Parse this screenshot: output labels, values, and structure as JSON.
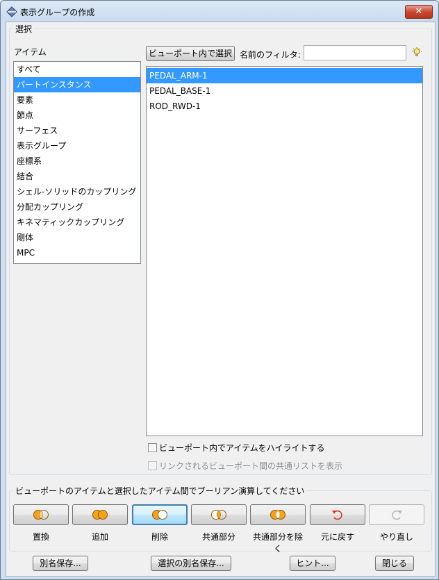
{
  "window": {
    "title": "表示グループの作成",
    "close_label": "✕"
  },
  "selection": {
    "group_label": "選択",
    "items_label": "アイテム",
    "items": [
      "すべて",
      "パートインスタンス",
      "要素",
      "節点",
      "サーフェス",
      "表示グループ",
      "座標系",
      "結合",
      "シェル-ソリッドのカップリング",
      "分配カップリング",
      "キネマティックカップリング",
      "剛体",
      "MPC"
    ],
    "selected_item": "パートインスタンス",
    "viewport_select_label": "ビューポート内で選択",
    "filter_label": "名前のフィルタ:",
    "filter_value": "",
    "instances": [
      "PEDAL_ARM-1",
      "PEDAL_BASE-1",
      "ROD_RWD-1"
    ],
    "selected_instance": "PEDAL_ARM-1",
    "highlight_checkbox": {
      "label": "ビューポート内でアイテムをハイライトする",
      "checked": false
    },
    "linked_checkbox": {
      "label": "リンクされるビューポート間の共通リストを表示",
      "checked": false,
      "enabled": false
    }
  },
  "boolean": {
    "group_label": "ビューポートのアイテムと選択したアイテム間でブーリアン演算してください",
    "ops": [
      {
        "label": "置換",
        "icon": "replace-icon"
      },
      {
        "label": "追加",
        "icon": "union-icon"
      },
      {
        "label": "削除",
        "icon": "remove-icon"
      },
      {
        "label": "共通部分",
        "icon": "intersect-icon"
      },
      {
        "label": "共通部分を除く",
        "icon": "exclusive-or-icon"
      },
      {
        "label": "元に戻す",
        "icon": "undo-icon"
      },
      {
        "label": "やり直し",
        "icon": "redo-icon"
      }
    ]
  },
  "footer": {
    "save_as": "別名保存...",
    "save_selection_as": "選択の別名保存...",
    "hint": "ヒント...",
    "close": "閉じる"
  },
  "colors": {
    "selection": "#3399ff",
    "accent": "#f7a21b",
    "undo": "#d9342b"
  }
}
